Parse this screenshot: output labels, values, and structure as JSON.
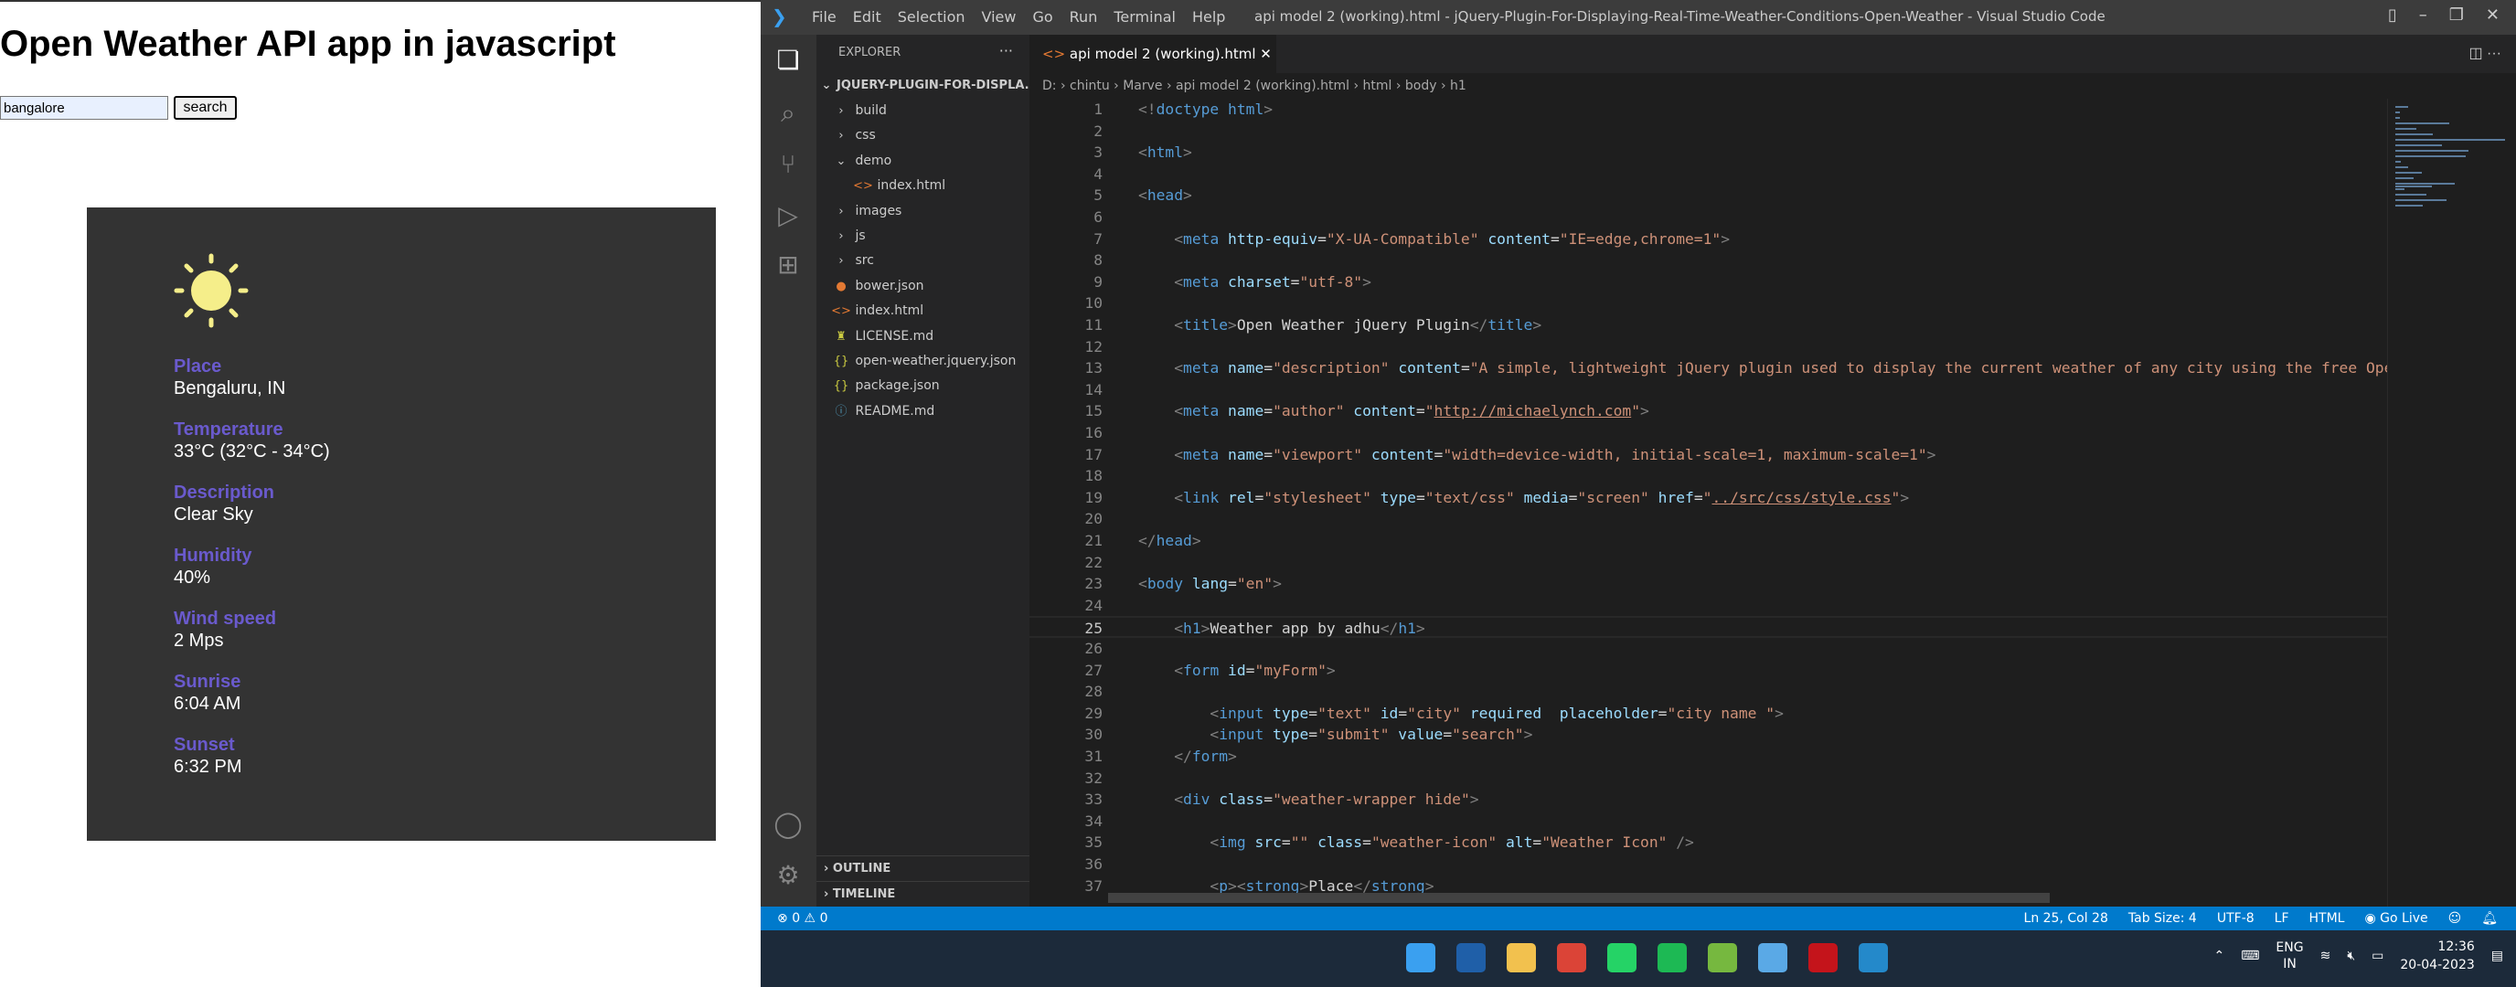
{
  "browser": {
    "heading": "Open Weather API app in javascript",
    "city_value": "bangalore",
    "search_label": "search",
    "weather": [
      {
        "label": "Place",
        "value": "Bengaluru, IN"
      },
      {
        "label": "Temperature",
        "value": "33°C (32°C - 34°C)"
      },
      {
        "label": "Description",
        "value": "Clear Sky"
      },
      {
        "label": "Humidity",
        "value": "40%"
      },
      {
        "label": "Wind speed",
        "value": "2 Mps"
      },
      {
        "label": "Sunrise",
        "value": "6:04 AM"
      },
      {
        "label": "Sunset",
        "value": "6:32 PM"
      }
    ],
    "weather_icon": "sun-icon",
    "sun_color": "#f5ee8a"
  },
  "vscode": {
    "menu": [
      "File",
      "Edit",
      "Selection",
      "View",
      "Go",
      "Run",
      "Terminal",
      "Help"
    ],
    "window_title": "api model 2 (working).html - jQuery-Plugin-For-Displaying-Real-Time-Weather-Conditions-Open-Weather - Visual Studio Code",
    "explorer_title": "EXPLORER",
    "root_folder": "JQUERY-PLUGIN-FOR-DISPLA...",
    "tree": [
      {
        "label": "build",
        "type": "folder",
        "icon": "›",
        "depth": 1
      },
      {
        "label": "css",
        "type": "folder",
        "icon": "›",
        "depth": 1
      },
      {
        "label": "demo",
        "type": "folder-open",
        "icon": "⌄",
        "depth": 1
      },
      {
        "label": "index.html",
        "type": "html",
        "icon": "<>",
        "depth": 2
      },
      {
        "label": "images",
        "type": "folder",
        "icon": "›",
        "depth": 1
      },
      {
        "label": "js",
        "type": "folder",
        "icon": "›",
        "depth": 1
      },
      {
        "label": "src",
        "type": "folder",
        "icon": "›",
        "depth": 1
      },
      {
        "label": "bower.json",
        "type": "bower",
        "icon": "●",
        "depth": 1
      },
      {
        "label": "index.html",
        "type": "html",
        "icon": "<>",
        "depth": 1
      },
      {
        "label": "LICENSE.md",
        "type": "license",
        "icon": "♜",
        "depth": 1
      },
      {
        "label": "open-weather.jquery.json",
        "type": "json",
        "icon": "{}",
        "depth": 1
      },
      {
        "label": "package.json",
        "type": "json",
        "icon": "{}",
        "depth": 1
      },
      {
        "label": "README.md",
        "type": "info",
        "icon": "ⓘ",
        "depth": 1
      }
    ],
    "outline": "OUTLINE",
    "timeline": "TIMELINE",
    "tab": "api model 2 (working).html",
    "breadcrumb": [
      "D:",
      "chintu",
      "Marve",
      "api model 2 (working).html",
      "html",
      "body",
      "h1"
    ],
    "code": [
      [
        [
          "p",
          "<!"
        ],
        [
          "n",
          "doctype"
        ],
        [
          "n",
          " html"
        ],
        [
          "p",
          ">"
        ]
      ],
      [],
      [
        [
          "p",
          "<"
        ],
        [
          "n",
          "html"
        ],
        [
          "p",
          ">"
        ]
      ],
      [],
      [
        [
          "p",
          "<"
        ],
        [
          "n",
          "head"
        ],
        [
          "p",
          ">"
        ]
      ],
      [],
      [
        [
          "x",
          "    "
        ],
        [
          "p",
          "<"
        ],
        [
          "n",
          "meta"
        ],
        [
          "a",
          " http-equiv"
        ],
        [
          "x",
          "="
        ],
        [
          "s",
          "\"X-UA-Compatible\""
        ],
        [
          "a",
          " content"
        ],
        [
          "x",
          "="
        ],
        [
          "s",
          "\"IE=edge,chrome=1\""
        ],
        [
          "p",
          ">"
        ]
      ],
      [],
      [
        [
          "x",
          "    "
        ],
        [
          "p",
          "<"
        ],
        [
          "n",
          "meta"
        ],
        [
          "a",
          " charset"
        ],
        [
          "x",
          "="
        ],
        [
          "s",
          "\"utf-8\""
        ],
        [
          "p",
          ">"
        ]
      ],
      [],
      [
        [
          "x",
          "    "
        ],
        [
          "p",
          "<"
        ],
        [
          "n",
          "title"
        ],
        [
          "p",
          ">"
        ],
        [
          "x",
          "Open Weather jQuery Plugin"
        ],
        [
          "p",
          "</"
        ],
        [
          "n",
          "title"
        ],
        [
          "p",
          ">"
        ]
      ],
      [],
      [
        [
          "x",
          "    "
        ],
        [
          "p",
          "<"
        ],
        [
          "n",
          "meta"
        ],
        [
          "a",
          " name"
        ],
        [
          "x",
          "="
        ],
        [
          "s",
          "\"description\""
        ],
        [
          "a",
          " content"
        ],
        [
          "x",
          "="
        ],
        [
          "s",
          "\"A simple, lightweight jQuery plugin used to display the current weather of any city using the free Open"
        ]
      ],
      [],
      [
        [
          "x",
          "    "
        ],
        [
          "p",
          "<"
        ],
        [
          "n",
          "meta"
        ],
        [
          "a",
          " name"
        ],
        [
          "x",
          "="
        ],
        [
          "s",
          "\"author\""
        ],
        [
          "a",
          " content"
        ],
        [
          "x",
          "="
        ],
        [
          "s",
          "\""
        ],
        [
          "u",
          "http://michaelynch.com"
        ],
        [
          "s",
          "\""
        ],
        [
          "p",
          ">"
        ]
      ],
      [],
      [
        [
          "x",
          "    "
        ],
        [
          "p",
          "<"
        ],
        [
          "n",
          "meta"
        ],
        [
          "a",
          " name"
        ],
        [
          "x",
          "="
        ],
        [
          "s",
          "\"viewport\""
        ],
        [
          "a",
          " content"
        ],
        [
          "x",
          "="
        ],
        [
          "s",
          "\"width=device-width, initial-scale=1, maximum-scale=1\""
        ],
        [
          "p",
          ">"
        ]
      ],
      [],
      [
        [
          "x",
          "    "
        ],
        [
          "p",
          "<"
        ],
        [
          "n",
          "link"
        ],
        [
          "a",
          " rel"
        ],
        [
          "x",
          "="
        ],
        [
          "s",
          "\"stylesheet\""
        ],
        [
          "a",
          " type"
        ],
        [
          "x",
          "="
        ],
        [
          "s",
          "\"text/css\""
        ],
        [
          "a",
          " media"
        ],
        [
          "x",
          "="
        ],
        [
          "s",
          "\"screen\""
        ],
        [
          "a",
          " href"
        ],
        [
          "x",
          "="
        ],
        [
          "s",
          "\""
        ],
        [
          "u",
          "../src/css/style.css"
        ],
        [
          "s",
          "\""
        ],
        [
          "p",
          ">"
        ]
      ],
      [],
      [
        [
          "p",
          "</"
        ],
        [
          "n",
          "head"
        ],
        [
          "p",
          ">"
        ]
      ],
      [],
      [
        [
          "p",
          "<"
        ],
        [
          "n",
          "body"
        ],
        [
          "a",
          " lang"
        ],
        [
          "x",
          "="
        ],
        [
          "s",
          "\"en\""
        ],
        [
          "p",
          ">"
        ]
      ],
      [],
      [
        [
          "x",
          "    "
        ],
        [
          "p",
          "<"
        ],
        [
          "n",
          "h1"
        ],
        [
          "p",
          ">"
        ],
        [
          "x",
          "Weather app by adhu"
        ],
        [
          "p",
          "</"
        ],
        [
          "n",
          "h1"
        ],
        [
          "p",
          ">"
        ]
      ],
      [],
      [
        [
          "x",
          "    "
        ],
        [
          "p",
          "<"
        ],
        [
          "n",
          "form"
        ],
        [
          "a",
          " id"
        ],
        [
          "x",
          "="
        ],
        [
          "s",
          "\"myForm\""
        ],
        [
          "p",
          ">"
        ]
      ],
      [],
      [
        [
          "x",
          "        "
        ],
        [
          "p",
          "<"
        ],
        [
          "n",
          "input"
        ],
        [
          "a",
          " type"
        ],
        [
          "x",
          "="
        ],
        [
          "s",
          "\"text\""
        ],
        [
          "a",
          " id"
        ],
        [
          "x",
          "="
        ],
        [
          "s",
          "\"city\""
        ],
        [
          "a",
          " required  placeholder"
        ],
        [
          "x",
          "="
        ],
        [
          "s",
          "\"city name \""
        ],
        [
          "p",
          ">"
        ]
      ],
      [
        [
          "x",
          "        "
        ],
        [
          "p",
          "<"
        ],
        [
          "n",
          "input"
        ],
        [
          "a",
          " type"
        ],
        [
          "x",
          "="
        ],
        [
          "s",
          "\"submit\""
        ],
        [
          "a",
          " value"
        ],
        [
          "x",
          "="
        ],
        [
          "s",
          "\"search\""
        ],
        [
          "p",
          ">"
        ]
      ],
      [
        [
          "x",
          "    "
        ],
        [
          "p",
          "</"
        ],
        [
          "n",
          "form"
        ],
        [
          "p",
          ">"
        ]
      ],
      [],
      [
        [
          "x",
          "    "
        ],
        [
          "p",
          "<"
        ],
        [
          "n",
          "div"
        ],
        [
          "a",
          " class"
        ],
        [
          "x",
          "="
        ],
        [
          "s",
          "\"weather-wrapper hide\""
        ],
        [
          "p",
          ">"
        ]
      ],
      [],
      [
        [
          "x",
          "        "
        ],
        [
          "p",
          "<"
        ],
        [
          "n",
          "img"
        ],
        [
          "a",
          " src"
        ],
        [
          "x",
          "="
        ],
        [
          "s",
          "\"\""
        ],
        [
          "a",
          " class"
        ],
        [
          "x",
          "="
        ],
        [
          "s",
          "\"weather-icon\""
        ],
        [
          "a",
          " alt"
        ],
        [
          "x",
          "="
        ],
        [
          "s",
          "\"Weather Icon\""
        ],
        [
          "p",
          " />"
        ]
      ],
      [],
      [
        [
          "x",
          "        "
        ],
        [
          "p",
          "<"
        ],
        [
          "n",
          "p"
        ],
        [
          "p",
          "><"
        ],
        [
          "n",
          "strong"
        ],
        [
          "p",
          ">"
        ],
        [
          "x",
          "Place"
        ],
        [
          "p",
          "</"
        ],
        [
          "n",
          "strong"
        ],
        [
          "p",
          ">"
        ]
      ]
    ],
    "current_line": 25,
    "status": {
      "errors": "0",
      "warnings": "0",
      "position": "Ln 25, Col 28",
      "tab_size": "Tab Size: 4",
      "encoding": "UTF-8",
      "eol": "LF",
      "language": "HTML",
      "go_live": "Go Live"
    },
    "status_color": "#007acc"
  },
  "taskbar": {
    "apps": [
      {
        "name": "start-icon",
        "color": "#3aa0f0"
      },
      {
        "name": "app-icon",
        "color": "#1f5fa8"
      },
      {
        "name": "file-explorer-icon",
        "color": "#f2c14e"
      },
      {
        "name": "chrome-icon",
        "color": "#db4437"
      },
      {
        "name": "whatsapp-icon",
        "color": "#25d366"
      },
      {
        "name": "spotify-icon",
        "color": "#1db954"
      },
      {
        "name": "utorrent-icon",
        "color": "#76b83f"
      },
      {
        "name": "notepad-icon",
        "color": "#5aa9e6"
      },
      {
        "name": "acrobat-icon",
        "color": "#c4141b"
      },
      {
        "name": "vscode-icon",
        "color": "#2489ca"
      }
    ],
    "lang": "ENG",
    "region": "IN",
    "time": "12:36",
    "date": "20-04-2023"
  }
}
